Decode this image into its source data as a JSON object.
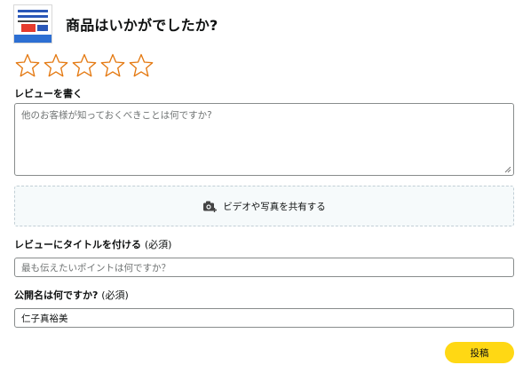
{
  "product": {
    "title": "商品はいかがでしたか?"
  },
  "rating": {
    "star_count": 5,
    "selected": 0,
    "star_color": "#e47911"
  },
  "review": {
    "label": "レビューを書く",
    "placeholder": "他のお客様が知っておくべきことは何ですか?"
  },
  "media": {
    "label": "ビデオや写真を共有する",
    "icon": "camera-plus-icon"
  },
  "title_field": {
    "label": "レビューにタイトルを付ける",
    "required_note": "(必須)",
    "placeholder": "最も伝えたいポイントは何ですか？"
  },
  "public_name": {
    "label": "公開名は何ですか?",
    "required_note": "(必須)",
    "value": "仁子真裕美"
  },
  "actions": {
    "submit_label": "投稿"
  },
  "colors": {
    "submit_bg": "#ffd814",
    "input_border": "#888c8c"
  }
}
